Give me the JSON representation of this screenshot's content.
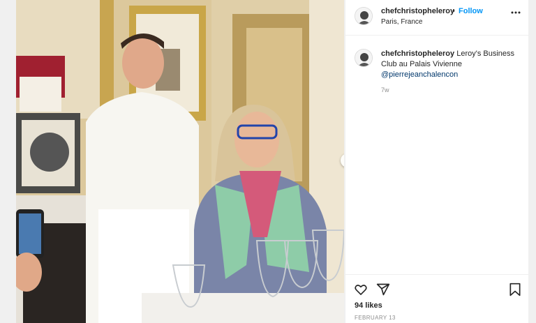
{
  "post": {
    "username": "chefchristopheleroy",
    "follow_sep": "•",
    "follow_label": "Follow",
    "location": "Paris, France",
    "caption_text": "Leroy's Business Club au Palais Vivienne",
    "caption_mention": "@pierrejeanchalencon",
    "time_ago": "7w",
    "likes": "94 likes",
    "date": "FEBRUARY 13"
  },
  "icons": {
    "more": "more-options-icon",
    "like": "heart-icon",
    "share": "share-icon",
    "save": "bookmark-icon",
    "next": "chevron-right-icon"
  },
  "colors": {
    "link": "#0095f6",
    "mention": "#00376b",
    "text": "#262626",
    "muted": "#8e8e8e"
  }
}
